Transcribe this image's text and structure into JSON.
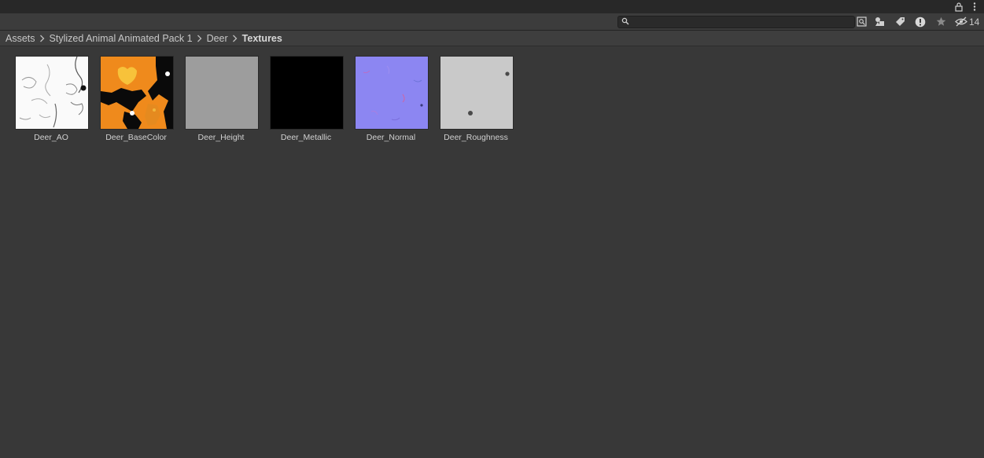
{
  "window": {
    "lock_icon": "lock-icon",
    "menu_icon": "kebab-menu-icon"
  },
  "toolbar": {
    "search": {
      "value": "",
      "placeholder": ""
    },
    "buttons": [
      "search-by-type-icon",
      "search-by-label-icon",
      "search-important-icon",
      "favorites-star-icon"
    ],
    "hidden_packages_count": "14"
  },
  "breadcrumb": [
    "Assets",
    "Stylized Animal Animated Pack 1",
    "Deer",
    "Textures"
  ],
  "assets": [
    {
      "name": "Deer_AO",
      "preview": "ao-texture-thumbnail"
    },
    {
      "name": "Deer_BaseColor",
      "preview": "basecolor-texture-thumbnail"
    },
    {
      "name": "Deer_Height",
      "preview": "height-texture-thumbnail"
    },
    {
      "name": "Deer_Metallic",
      "preview": "metallic-texture-thumbnail"
    },
    {
      "name": "Deer_Normal",
      "preview": "normal-texture-thumbnail"
    },
    {
      "name": "Deer_Roughness",
      "preview": "roughness-texture-thumbnail"
    }
  ],
  "colors": {
    "background": "#383838",
    "base_orange": "#ef8a1c",
    "normal_blue": "#8c86f2",
    "height_gray": "#9d9d9d",
    "roughness_gray": "#c9c9c9"
  }
}
